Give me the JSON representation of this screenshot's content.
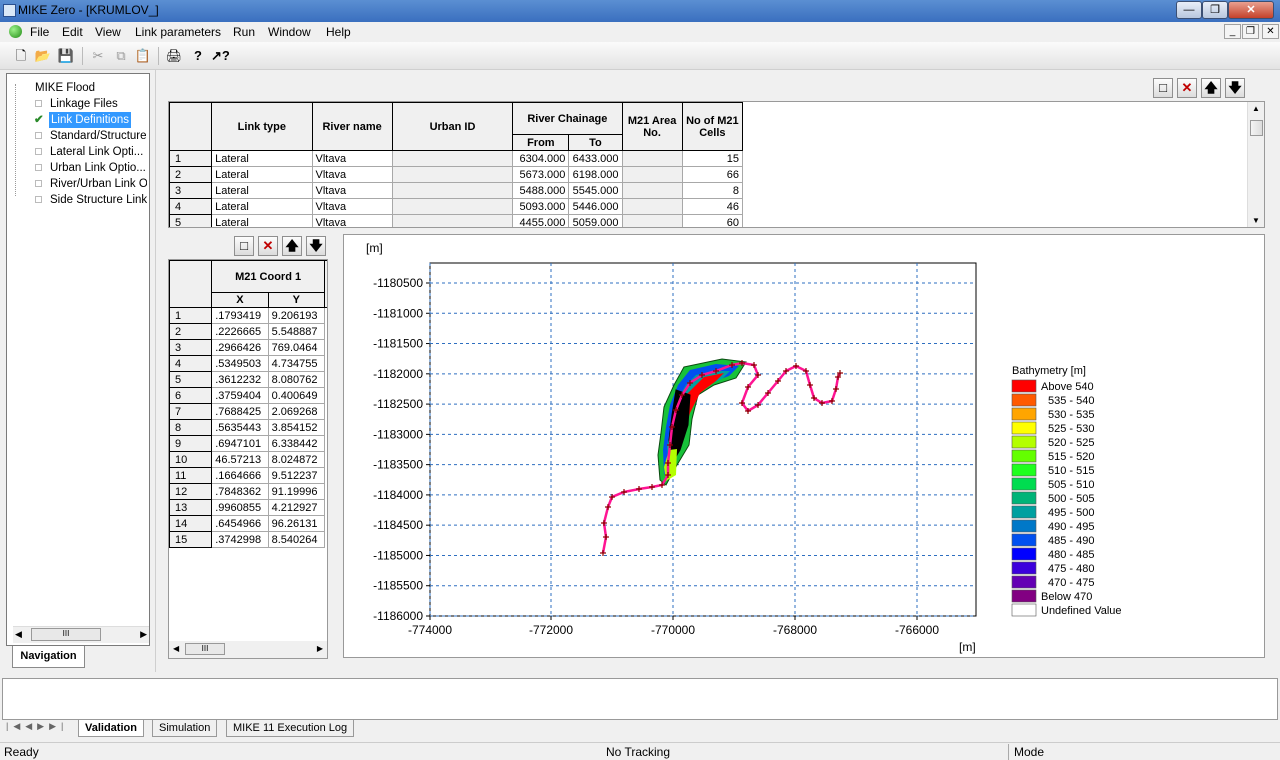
{
  "window": {
    "title": "MIKE Zero - [KRUMLOV_]"
  },
  "menu": [
    "File",
    "Edit",
    "View",
    "Link parameters",
    "Run",
    "Window",
    "Help"
  ],
  "navigation": {
    "root": "MIKE Flood",
    "items": [
      {
        "label": "Linkage Files",
        "checked": false,
        "selected": false
      },
      {
        "label": "Link Definitions",
        "checked": true,
        "selected": true
      },
      {
        "label": "Standard/Structure",
        "checked": false,
        "selected": false
      },
      {
        "label": "Lateral Link Opti...",
        "checked": false,
        "selected": false
      },
      {
        "label": "Urban Link Optio...",
        "checked": false,
        "selected": false
      },
      {
        "label": "River/Urban Link Op",
        "checked": false,
        "selected": false
      },
      {
        "label": "Side Structure Link (",
        "checked": false,
        "selected": false
      }
    ],
    "tab": "Navigation"
  },
  "link_table": {
    "headers": {
      "link_type": "Link type",
      "river_name": "River name",
      "urban_id": "Urban ID",
      "river_chainage": "River Chainage",
      "from": "From",
      "to": "To",
      "m21_area": "M21 Area No.",
      "cells": "No of M21 Cells"
    },
    "rows": [
      {
        "n": "1",
        "type": "Lateral",
        "river": "Vltava",
        "from": "6304.000",
        "to": "6433.000",
        "cells": "15"
      },
      {
        "n": "2",
        "type": "Lateral",
        "river": "Vltava",
        "from": "5673.000",
        "to": "6198.000",
        "cells": "66"
      },
      {
        "n": "3",
        "type": "Lateral",
        "river": "Vltava",
        "from": "5488.000",
        "to": "5545.000",
        "cells": "8"
      },
      {
        "n": "4",
        "type": "Lateral",
        "river": "Vltava",
        "from": "5093.000",
        "to": "5446.000",
        "cells": "46"
      },
      {
        "n": "5",
        "type": "Lateral",
        "river": "Vltava",
        "from": "4455.000",
        "to": "5059.000",
        "cells": "60"
      }
    ]
  },
  "coord_table": {
    "header": "M21 Coord 1",
    "x_label": "X",
    "y_label": "Y",
    "rows": [
      {
        "n": "1",
        "x": ".1793419",
        "y": "9.206193"
      },
      {
        "n": "2",
        "x": ".2226665",
        "y": "5.548887"
      },
      {
        "n": "3",
        "x": ".2966426",
        "y": "769.0464"
      },
      {
        "n": "4",
        "x": ".5349503",
        "y": "4.734755"
      },
      {
        "n": "5",
        "x": ".3612232",
        "y": "8.080762"
      },
      {
        "n": "6",
        "x": ".3759404",
        "y": "0.400649"
      },
      {
        "n": "7",
        "x": ".7688425",
        "y": "2.069268"
      },
      {
        "n": "8",
        "x": ".5635443",
        "y": "3.854152"
      },
      {
        "n": "9",
        "x": ".6947101",
        "y": "6.338442"
      },
      {
        "n": "10",
        "x": "46.57213",
        "y": "8.024872"
      },
      {
        "n": "11",
        "x": ".1664666",
        "y": "9.512237"
      },
      {
        "n": "12",
        "x": ".7848362",
        "y": "91.19996"
      },
      {
        "n": "13",
        "x": ".9960855",
        "y": "4.212927"
      },
      {
        "n": "14",
        "x": ".6454966",
        "y": "96.26131"
      },
      {
        "n": "15",
        "x": ".3742998",
        "y": "8.540264"
      }
    ]
  },
  "plot": {
    "y_unit": "[m]",
    "x_unit": "[m]",
    "y_ticks": [
      "-1180500",
      "-1181000",
      "-1181500",
      "-1182000",
      "-1182500",
      "-1183000",
      "-1183500",
      "-1184000",
      "-1184500",
      "-1185000",
      "-1185500",
      "-1186000"
    ],
    "x_ticks": [
      "-774000",
      "-772000",
      "-770000",
      "-768000",
      "-766000"
    ],
    "legend_title": "Bathymetry [m]",
    "legend": [
      {
        "label": "Above 540",
        "color": "#ff0000"
      },
      {
        "label": "535 - 540",
        "color": "#ff5a00"
      },
      {
        "label": "530 - 535",
        "color": "#ffa500"
      },
      {
        "label": "525 - 530",
        "color": "#ffff00"
      },
      {
        "label": "520 - 525",
        "color": "#b4ff00"
      },
      {
        "label": "515 - 520",
        "color": "#64ff00"
      },
      {
        "label": "510 - 515",
        "color": "#1eff1e"
      },
      {
        "label": "505 - 510",
        "color": "#00dc50"
      },
      {
        "label": "500 - 505",
        "color": "#00b478"
      },
      {
        "label": "495 - 500",
        "color": "#00a0a0"
      },
      {
        "label": "490 - 495",
        "color": "#0078c8"
      },
      {
        "label": "485 - 490",
        "color": "#0050f0"
      },
      {
        "label": "480 - 485",
        "color": "#0000ff"
      },
      {
        "label": "475 - 480",
        "color": "#3c00dc"
      },
      {
        "label": "470 - 475",
        "color": "#6400b4"
      },
      {
        "label": "Below 470",
        "color": "#820082"
      },
      {
        "label": "Undefined Value",
        "color": "#ffffff"
      }
    ]
  },
  "bottom_tabs": [
    "Validation",
    "Simulation",
    "MIKE 11 Execution Log"
  ],
  "status": {
    "left": "Ready",
    "center": "No Tracking",
    "right": "Mode"
  }
}
